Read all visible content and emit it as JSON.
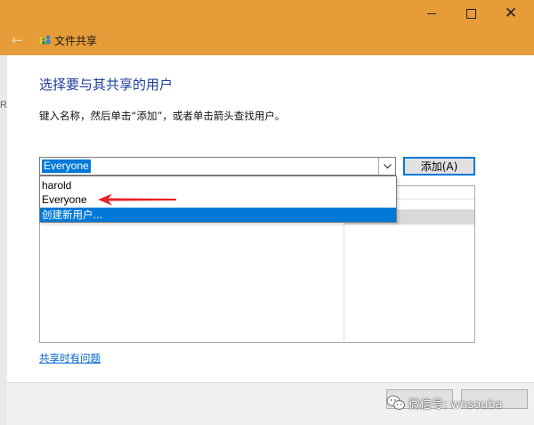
{
  "window": {
    "title": "文件共享",
    "controls": {
      "minimize": "—",
      "maximize": "☐",
      "close": "✕"
    },
    "back": "←",
    "accent_color": "#e69c38"
  },
  "behind_window": {
    "edge_text": "R"
  },
  "main": {
    "heading": "选择要与其共享的用户",
    "instruction": "键入名称，然后单击“添加”，或者单击箭头查找用户。",
    "combo": {
      "value": "Everyone",
      "dropdown_icon": "chevron-down-icon"
    },
    "add_button": "添加(A)",
    "dropdown_items": [
      {
        "label": "harold"
      },
      {
        "label": "Everyone"
      },
      {
        "label": "创建新用户..."
      }
    ],
    "help_link": "共享时有问题"
  },
  "watermark": {
    "text": "微信号: wnsouba"
  }
}
